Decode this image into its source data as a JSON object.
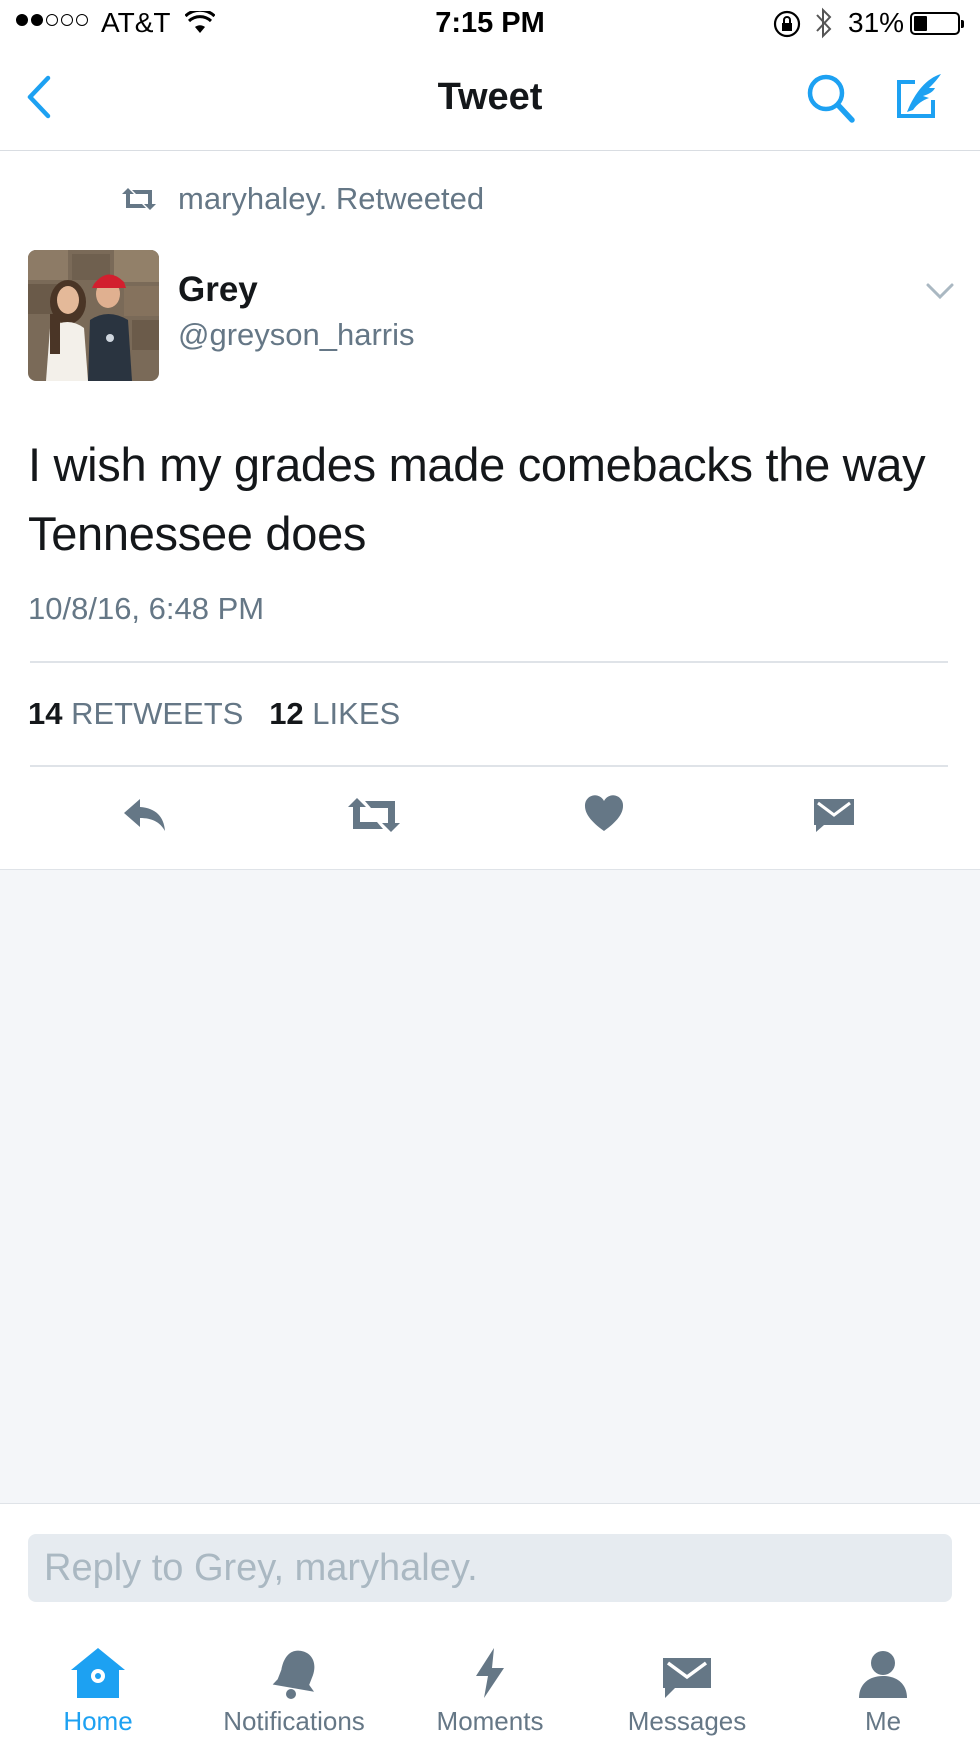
{
  "status_bar": {
    "carrier": "AT&T",
    "time": "7:15 PM",
    "battery_percent": "31%",
    "battery_level": 0.31,
    "signal_bars_filled": 2,
    "signal_bars_total": 5
  },
  "nav": {
    "title": "Tweet",
    "back_icon": "chevron-left-icon",
    "search_icon": "search-icon",
    "compose_icon": "compose-tweet-icon"
  },
  "tweet": {
    "retweeted_by": "maryhaley. Retweeted",
    "author_name": "Grey",
    "author_handle": "@greyson_harris",
    "text": "I wish my grades made comebacks the way Tennessee does",
    "timestamp": "10/8/16, 6:48 PM",
    "retweets_count": "14",
    "retweets_label": "RETWEETS",
    "likes_count": "12",
    "likes_label": "LIKES"
  },
  "actions": [
    "reply-icon",
    "retweet-icon",
    "like-icon",
    "direct-message-icon"
  ],
  "reply": {
    "placeholder": "Reply to Grey, maryhaley."
  },
  "tabbar": {
    "items": [
      {
        "label": "Home",
        "icon": "home-icon",
        "active": true
      },
      {
        "label": "Notifications",
        "icon": "bell-icon",
        "active": false
      },
      {
        "label": "Moments",
        "icon": "lightning-icon",
        "active": false
      },
      {
        "label": "Messages",
        "icon": "envelope-icon",
        "active": false
      },
      {
        "label": "Me",
        "icon": "person-icon",
        "active": false
      }
    ]
  },
  "colors": {
    "accent": "#1da1f2",
    "secondary_text": "#657786",
    "primary_text": "#14171a",
    "background_gray": "#f4f6f9"
  }
}
